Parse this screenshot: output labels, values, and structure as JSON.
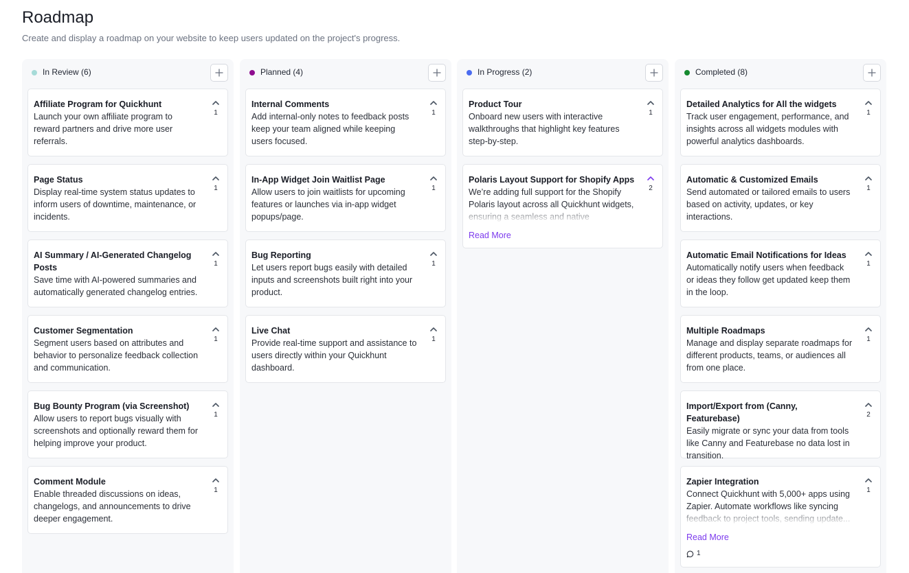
{
  "page": {
    "title": "Roadmap",
    "subtitle": "Create and display a roadmap on your website to keep users updated on the project's progress."
  },
  "icons": {
    "add": "plus-icon",
    "vote": "chevron-up-icon",
    "comment": "comment-bubble-icon"
  },
  "colors": {
    "in_review": "#a6dbd8",
    "planned": "#8e0c8f",
    "in_progress": "#4b6cf0",
    "completed": "#168a2f",
    "accent": "#7c3aed"
  },
  "columns": [
    {
      "title": "In Review (6)",
      "cards": [
        {
          "title": "Affiliate Program for Quickhunt",
          "description": "Launch your own affiliate program to reward partners and drive more user referrals.",
          "votes": "1"
        },
        {
          "title": "Page Status",
          "description": "Display real-time system status updates to inform users of downtime, maintenance, or incidents.",
          "votes": "1"
        },
        {
          "title": "AI Summary / AI-Generated Changelog Posts",
          "description": "Save time with AI-powered summaries and automatically generated changelog entries.",
          "votes": "1"
        },
        {
          "title": "Customer Segmentation",
          "description": "Segment users based on attributes and behavior to personalize feedback collection and communication.",
          "votes": "1"
        },
        {
          "title": "Bug Bounty Program (via Screenshot)",
          "description": "Allow users to report bugs visually with screenshots and optionally reward them for helping improve your product.",
          "votes": "1"
        },
        {
          "title": "Comment Module",
          "description": "Enable threaded discussions on ideas, changelogs, and announcements to drive deeper engagement.",
          "votes": "1"
        }
      ]
    },
    {
      "title": "Planned (4)",
      "cards": [
        {
          "title": "Internal Comments",
          "description": "Add internal-only notes to feedback posts keep your team aligned while keeping users focused.",
          "votes": "1"
        },
        {
          "title": "In-App Widget Join Waitlist Page",
          "description": "Allow users to join waitlists for upcoming features or launches via in-app widget popups/page.",
          "votes": "1"
        },
        {
          "title": "Bug Reporting",
          "description": "Let users report bugs easily with detailed inputs and screenshots built right into your product.",
          "votes": "1"
        },
        {
          "title": "Live Chat",
          "description": "Provide real-time support and assistance to users directly within your Quickhunt dashboard.",
          "votes": "1"
        }
      ]
    },
    {
      "title": "In Progress (2)",
      "cards": [
        {
          "title": "Product Tour",
          "description": "Onboard new users with interactive walkthroughs that highlight key features step-by-step.",
          "votes": "1"
        },
        {
          "title": "Polaris Layout Support for Shopify Apps",
          "description": "We’re adding full support for the Shopify Polaris layout across all Quickhunt widgets, ensuring a seamless and native experienc...",
          "votes": "2",
          "read_more": "Read More"
        }
      ]
    },
    {
      "title": "Completed (8)",
      "cards": [
        {
          "title": "Detailed Analytics for All the widgets",
          "description": "Track user engagement, performance, and insights across all widgets modules with powerful analytics dashboards.",
          "votes": "1"
        },
        {
          "title": "Automatic & Customized Emails",
          "description": "Send automated or tailored emails to users based on activity, updates, or key interactions.",
          "votes": "1"
        },
        {
          "title": "Automatic Email Notifications for Ideas",
          "description": "Automatically notify users when feedback or ideas they follow get updated keep them in the loop.",
          "votes": "1"
        },
        {
          "title": "Multiple Roadmaps",
          "description": "Manage and display separate roadmaps for different products, teams, or audiences all from one place.",
          "votes": "1"
        },
        {
          "title": "Import/Export from (Canny, Featurebase)",
          "description": "Easily migrate or sync your data from tools like Canny and Featurebase no data lost in transition.",
          "votes": "2"
        },
        {
          "title": "Zapier Integration",
          "description": "Connect Quickhunt with 5,000+ apps using Zapier. Automate workflows like syncing feedback to project tools, sending update...",
          "votes": "1",
          "read_more": "Read More",
          "comments": "1"
        }
      ]
    }
  ]
}
